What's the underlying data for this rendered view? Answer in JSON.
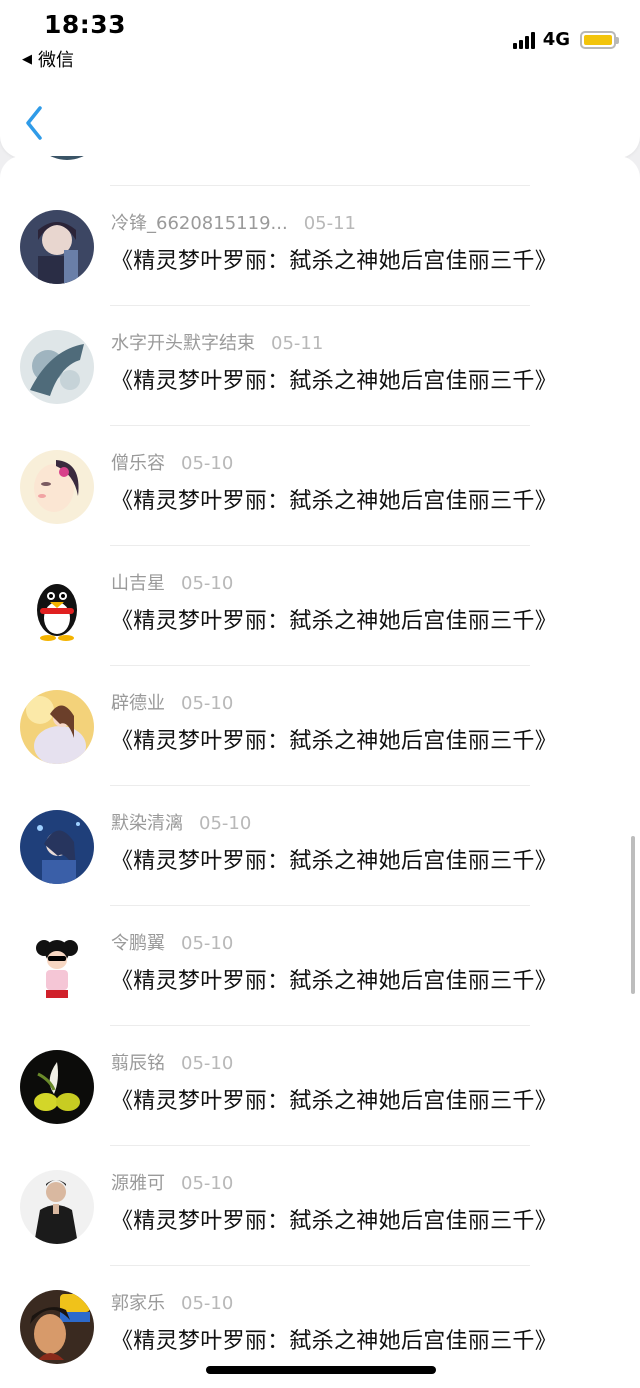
{
  "status_bar": {
    "time": "18:33",
    "back_app": "微信",
    "network": "4G"
  },
  "nav": {
    "back_icon": "chevron-left-icon",
    "accent_color": "#2f9be8"
  },
  "items": [
    {
      "name": "冷锋_6620815119...",
      "date": "05-11",
      "message": "《精灵梦叶罗丽：弑杀之神她后宫佳丽三千》",
      "avatar": "anime-boy-avatar"
    },
    {
      "name": "水字开头默字结束",
      "date": "05-11",
      "message": "《精灵梦叶罗丽：弑杀之神她后宫佳丽三千》",
      "avatar": "ink-art-avatar"
    },
    {
      "name": "僧乐容",
      "date": "05-10",
      "message": "《精灵梦叶罗丽：弑杀之神她后宫佳丽三千》",
      "avatar": "cartoon-girl-avatar"
    },
    {
      "name": "山吉星",
      "date": "05-10",
      "message": "《精灵梦叶罗丽：弑杀之神她后宫佳丽三千》",
      "avatar": "penguin-avatar"
    },
    {
      "name": "辟德业",
      "date": "05-10",
      "message": "《精灵梦叶罗丽：弑杀之神她后宫佳丽三千》",
      "avatar": "fantasy-girl-avatar"
    },
    {
      "name": "默染清漓",
      "date": "05-10",
      "message": "《精灵梦叶罗丽：弑杀之神她后宫佳丽三千》",
      "avatar": "anime-blue-avatar"
    },
    {
      "name": "令鹏翼",
      "date": "05-10",
      "message": "《精灵梦叶罗丽：弑杀之神她后宫佳丽三千》",
      "avatar": "cartoon-kid-avatar"
    },
    {
      "name": "翦辰铭",
      "date": "05-10",
      "message": "《精灵梦叶罗丽：弑杀之神她后宫佳丽三千》",
      "avatar": "flower-avatar"
    },
    {
      "name": "源雅可",
      "date": "05-10",
      "message": "《精灵梦叶罗丽：弑杀之神她后宫佳丽三千》",
      "avatar": "man-photo-avatar"
    },
    {
      "name": "郭家乐",
      "date": "05-10",
      "message": "《精灵梦叶罗丽：弑杀之神她后宫佳丽三千》",
      "avatar": "game-hero-avatar"
    }
  ]
}
